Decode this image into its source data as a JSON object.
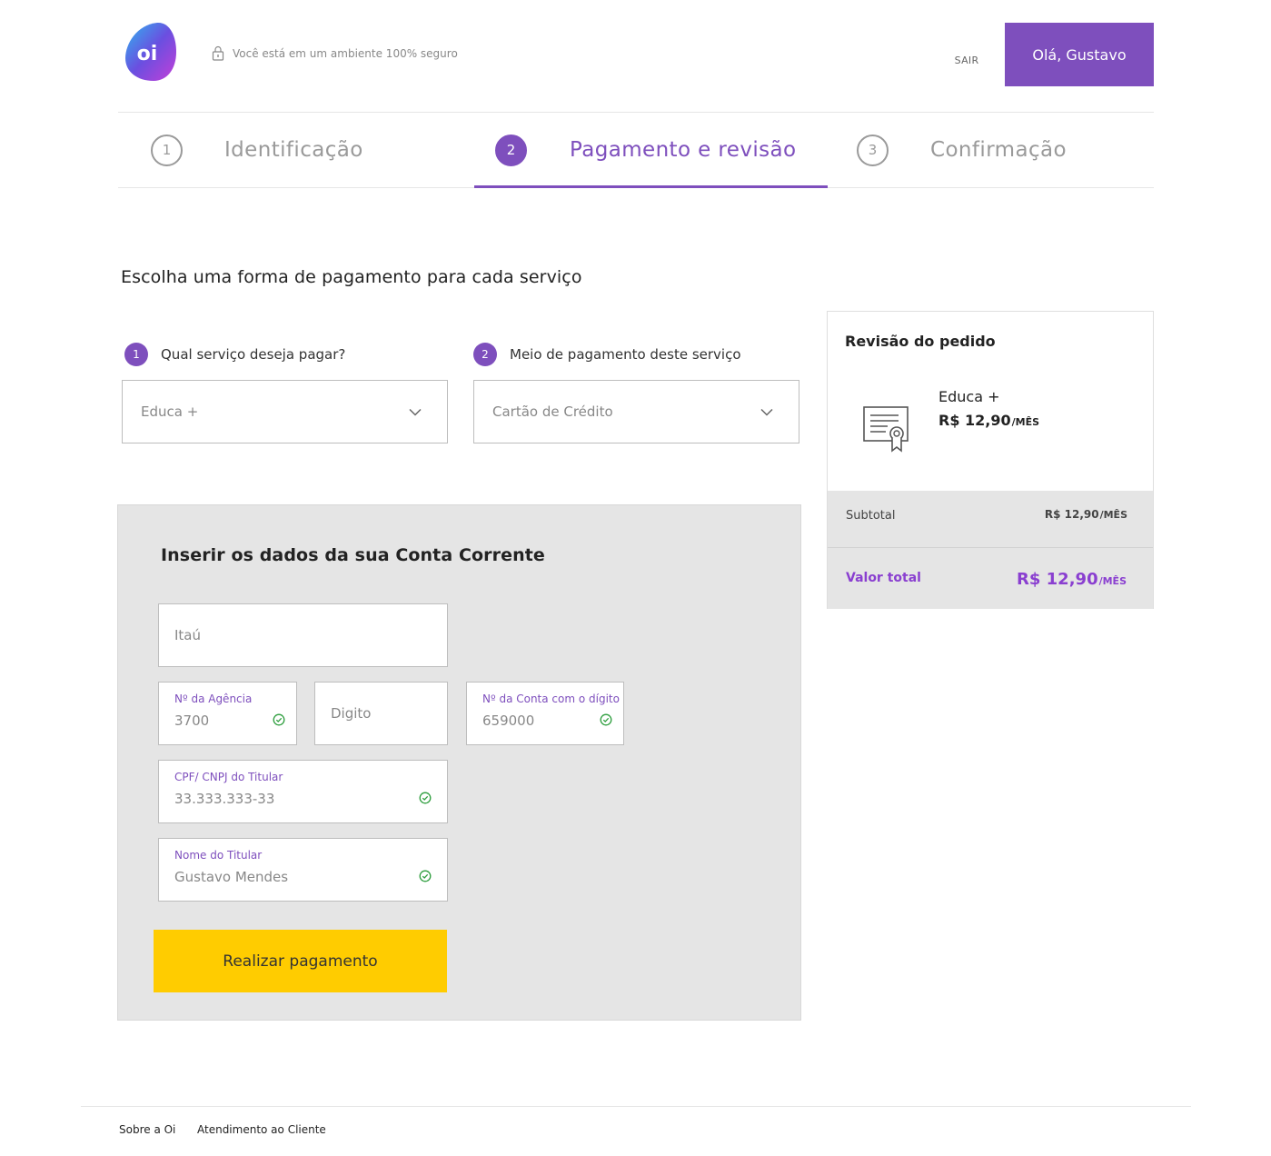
{
  "header": {
    "secure_text": "Você está em um ambiente 100% seguro",
    "logout_label": "SAIR",
    "greeting": "Olá, Gustavo",
    "logo_text": "oi"
  },
  "steps": [
    {
      "number": "1",
      "label": "Identificação",
      "active": false
    },
    {
      "number": "2",
      "label": "Pagamento e revisão",
      "active": true
    },
    {
      "number": "3",
      "label": "Confirmação",
      "active": false
    }
  ],
  "main": {
    "title": "Escolha uma forma de pagamento para cada serviço",
    "service_field": {
      "badge": "1",
      "label": "Qual serviço deseja pagar?",
      "value": "Educa +"
    },
    "method_field": {
      "badge": "2",
      "label": "Meio de pagamento deste serviço",
      "value": "Cartão de Crédito"
    }
  },
  "account_form": {
    "title": "Inserir os dados da sua Conta Corrente",
    "bank": {
      "placeholder": "Itaú"
    },
    "agency": {
      "label": "Nº da Agência",
      "value": "3700"
    },
    "digit": {
      "placeholder": "Digito"
    },
    "account": {
      "label": "Nº da Conta com o dígito",
      "value": "659000"
    },
    "cpf": {
      "label": "CPF/ CNPJ do Titular",
      "value": "33.333.333-33"
    },
    "holder": {
      "label": "Nome do Titular",
      "value": "Gustavo Mendes"
    },
    "submit_label": "Realizar pagamento"
  },
  "review": {
    "title": "Revisão do pedido",
    "product_name": "Educa +",
    "product_price": "R$ 12,90",
    "price_suffix": "/MÊS",
    "subtotal_label": "Subtotal",
    "subtotal_value": "R$ 12,90",
    "total_label": "Valor total",
    "total_value": "R$ 12,90"
  },
  "footer": {
    "links": [
      "Sobre a Oi",
      "Atendimento ao Cliente"
    ]
  },
  "colors": {
    "brand_purple": "#7e4fbd",
    "accent_yellow": "#ffcc00",
    "success_green": "#2e9e3e",
    "total_purple": "#8a3fd0"
  }
}
